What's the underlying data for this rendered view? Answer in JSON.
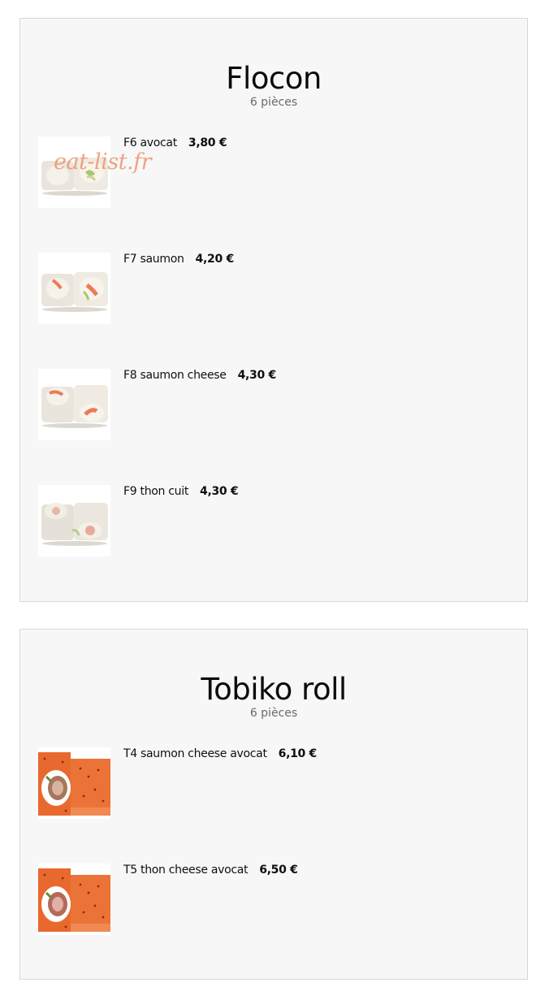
{
  "watermark": "eat-list.fr",
  "sections": [
    {
      "title": "Flocon",
      "subtitle": "6 pièces",
      "items": [
        {
          "name": "F6 avocat",
          "price": "3,80 €",
          "image": "maki-roll-avocado"
        },
        {
          "name": "F7 saumon",
          "price": "4,20 €",
          "image": "maki-roll-salmon"
        },
        {
          "name": "F8 saumon cheese",
          "price": "4,30 €",
          "image": "maki-roll-salmon-cheese"
        },
        {
          "name": "F9 thon cuit",
          "price": "4,30 €",
          "image": "maki-roll-cooked-tuna"
        }
      ]
    },
    {
      "title": "Tobiko roll",
      "subtitle": "6 pièces",
      "items": [
        {
          "name": "T4 saumon cheese avocat",
          "price": "6,10 €",
          "image": "tobiko-roll-salmon"
        },
        {
          "name": "T5 thon cheese avocat",
          "price": "6,50 €",
          "image": "tobiko-roll-tuna"
        }
      ]
    }
  ]
}
